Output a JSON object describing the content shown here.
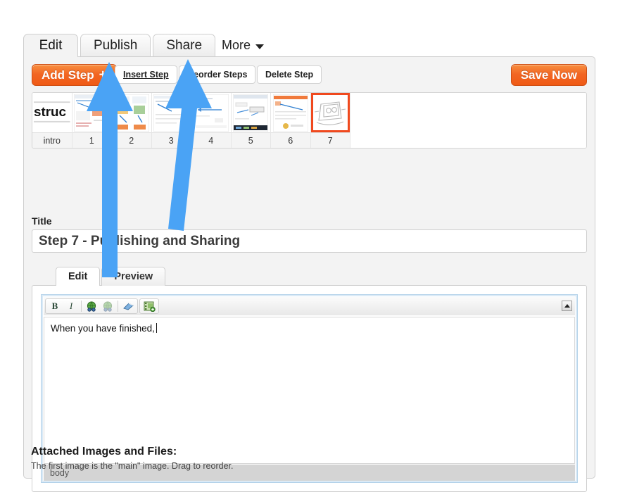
{
  "tabs": {
    "items": [
      {
        "label": "Edit",
        "active": true
      },
      {
        "label": "Publish",
        "active": false
      },
      {
        "label": "Share",
        "active": false
      }
    ],
    "more_label": "More"
  },
  "toolbar": {
    "add_step_label": "Add Step",
    "add_step_glyph": "+",
    "insert_step_label": "Insert Step",
    "reorder_steps_label": "Reorder Steps",
    "delete_step_label": "Delete Step",
    "save_now_label": "Save Now"
  },
  "step_strip": {
    "steps": [
      {
        "label": "intro",
        "selected": false,
        "kind": "text"
      },
      {
        "label": "1",
        "selected": false,
        "kind": "screenshot"
      },
      {
        "label": "2",
        "selected": false,
        "kind": "screenshot"
      },
      {
        "label": "3",
        "selected": false,
        "kind": "screenshot"
      },
      {
        "label": "4",
        "selected": false,
        "kind": "screenshot"
      },
      {
        "label": "5",
        "selected": false,
        "kind": "screenshot"
      },
      {
        "label": "6",
        "selected": false,
        "kind": "screenshot"
      },
      {
        "label": "7",
        "selected": true,
        "kind": "robot-sketch"
      }
    ],
    "intro_thumb_text": "struc",
    "selection_color": "#f0491e"
  },
  "title_field": {
    "label": "Title",
    "value": "Step 7 - Publishing and Sharing"
  },
  "editor": {
    "subtabs": [
      {
        "label": "Edit",
        "active": true
      },
      {
        "label": "Preview",
        "active": false
      }
    ],
    "rich_toolbar": [
      {
        "name": "bold-icon",
        "glyph": "B"
      },
      {
        "name": "italic-icon",
        "glyph": "I"
      },
      {
        "name": "link-icon",
        "glyph": "link"
      },
      {
        "name": "unlink-icon",
        "glyph": "unlink"
      },
      {
        "name": "remove-format-icon",
        "glyph": "eraser"
      },
      {
        "name": "insert-image-icon",
        "glyph": "filmstrip"
      }
    ],
    "body_text": "When you have finished,",
    "status_path": "body",
    "scroll_up_icon": "triangle-up"
  },
  "attachments": {
    "heading": "Attached Images and Files:",
    "subtext": "The first image is the \"main\" image. Drag to reorder."
  },
  "annotations": {
    "arrow_color": "#4aa3f5",
    "arrows": [
      {
        "name": "arrow-to-insert-step",
        "target": "Insert Step"
      },
      {
        "name": "arrow-to-reorder-steps",
        "target": "Reorder Steps"
      }
    ]
  },
  "colors": {
    "accent_orange": "#f26522",
    "panel_bg": "#f3f3f3",
    "arrow_blue": "#4aa3f5"
  }
}
